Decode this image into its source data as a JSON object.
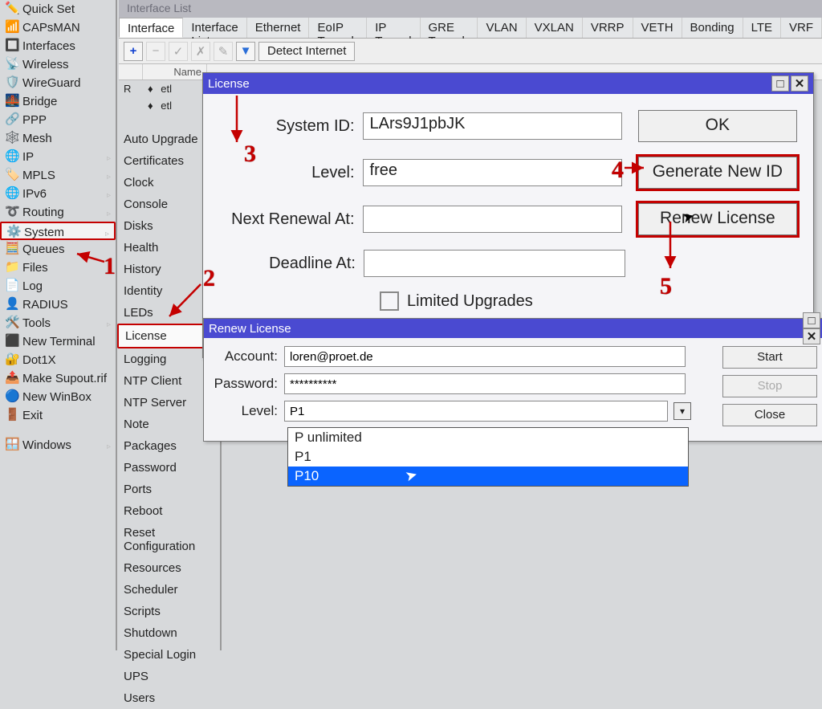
{
  "sidebar": {
    "items": [
      {
        "label": "Quick Set"
      },
      {
        "label": "CAPsMAN"
      },
      {
        "label": "Interfaces"
      },
      {
        "label": "Wireless"
      },
      {
        "label": "WireGuard"
      },
      {
        "label": "Bridge"
      },
      {
        "label": "PPP"
      },
      {
        "label": "Mesh"
      },
      {
        "label": "IP",
        "arrow": true
      },
      {
        "label": "MPLS",
        "arrow": true
      },
      {
        "label": "IPv6",
        "arrow": true
      },
      {
        "label": "Routing",
        "arrow": true
      },
      {
        "label": "System",
        "arrow": true,
        "sel": true
      },
      {
        "label": "Queues"
      },
      {
        "label": "Files"
      },
      {
        "label": "Log"
      },
      {
        "label": "RADIUS"
      },
      {
        "label": "Tools",
        "arrow": true
      },
      {
        "label": "New Terminal"
      },
      {
        "label": "Dot1X"
      },
      {
        "label": "Make Supout.rif"
      },
      {
        "label": "New WinBox"
      },
      {
        "label": "Exit"
      }
    ],
    "windows": "Windows"
  },
  "submenu": {
    "items": [
      "Auto Upgrade",
      "Certificates",
      "Clock",
      "Console",
      "Disks",
      "Health",
      "History",
      "Identity",
      "LEDs",
      "License",
      "Logging",
      "NTP Client",
      "NTP Server",
      "Note",
      "Packages",
      "Password",
      "Ports",
      "Reboot",
      "Reset Configuration",
      "Resources",
      "Scheduler",
      "Scripts",
      "Shutdown",
      "Special Login",
      "UPS",
      "Users"
    ],
    "selected": "License"
  },
  "interface_list": {
    "title": "Interface List",
    "tabs": [
      "Interface",
      "Interface List",
      "Ethernet",
      "EoIP Tunnel",
      "IP Tunnel",
      "GRE Tunnel",
      "VLAN",
      "VXLAN",
      "VRRP",
      "VETH",
      "Bonding",
      "LTE",
      "VRF"
    ],
    "toolbar": {
      "add": "+",
      "detect": "Detect Internet"
    },
    "columns": [
      "",
      "Name"
    ],
    "rows": [
      {
        "flag": "R",
        "name": "etl"
      },
      {
        "flag": "",
        "name": "etl"
      }
    ]
  },
  "license": {
    "title": "License",
    "system_id_lab": "System ID:",
    "system_id": "LArs9J1pbJK",
    "level_lab": "Level:",
    "level": "free",
    "next_lab": "Next Renewal At:",
    "next": "",
    "deadline_lab": "Deadline At:",
    "deadline": "",
    "limited": "Limited Upgrades",
    "btn_ok": "OK",
    "btn_gen": "Generate New ID",
    "btn_renew": "Renew License"
  },
  "renew": {
    "title": "Renew License",
    "account_lab": "Account:",
    "account": "loren@proet.de",
    "password_lab": "Password:",
    "password": "**********",
    "level_lab": "Level:",
    "level": "P1",
    "options": [
      "P unlimited",
      "P1",
      "P10"
    ],
    "start": "Start",
    "stop": "Stop",
    "close": "Close"
  },
  "steps": {
    "s1": "1",
    "s2": "2",
    "s3": "3",
    "s4": "4",
    "s5": "5"
  }
}
